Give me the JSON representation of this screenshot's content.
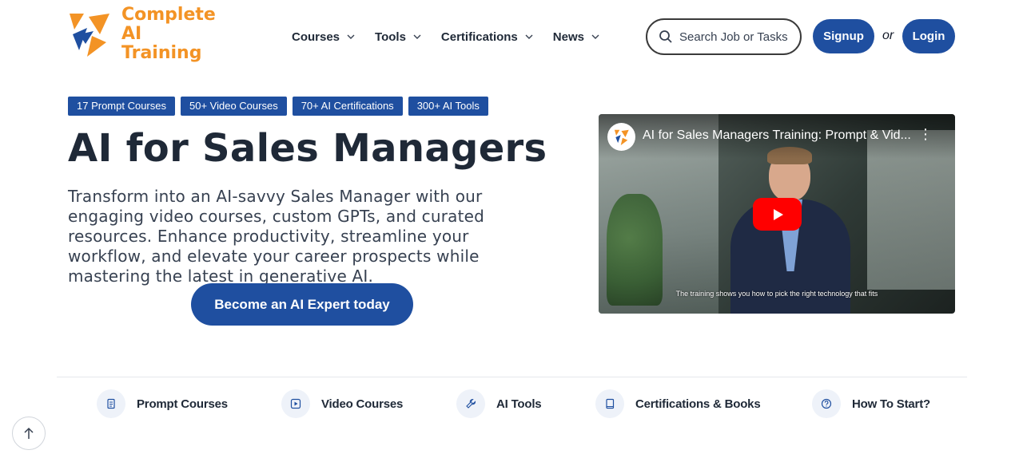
{
  "logo": {
    "line1": "Complete",
    "line2": "AI Training"
  },
  "nav": [
    {
      "label": "Courses"
    },
    {
      "label": "Tools"
    },
    {
      "label": "Certifications"
    },
    {
      "label": "News"
    }
  ],
  "search": {
    "placeholder": "Search Job or Tasks"
  },
  "auth": {
    "signup": "Signup",
    "or": "or",
    "login": "Login"
  },
  "badges": [
    "17 Prompt Courses",
    "50+ Video Courses",
    "70+ AI Certifications",
    "300+ AI Tools"
  ],
  "hero": {
    "title": "AI for Sales Managers",
    "description": "Transform into an AI-savvy Sales Manager with our engaging video courses, custom GPTs, and curated resources. Enhance productivity, streamline your workflow, and elevate your career prospects while mastering the latest in generative AI.",
    "cta": "Become an AI Expert today"
  },
  "video": {
    "title": "AI for Sales Managers Training: Prompt & Vid...",
    "caption": "The training shows you how to pick the right technology that fits"
  },
  "bottom_nav": [
    {
      "label": "Prompt Courses",
      "icon": "document-icon"
    },
    {
      "label": "Video Courses",
      "icon": "play-square-icon"
    },
    {
      "label": "AI Tools",
      "icon": "wrench-icon"
    },
    {
      "label": "Certifications & Books",
      "icon": "book-icon"
    },
    {
      "label": "How To Start?",
      "icon": "question-icon"
    }
  ],
  "colors": {
    "primary": "#1f4fa0",
    "logo_orange": "#f39325",
    "logo_blue": "#1f4fa0"
  }
}
